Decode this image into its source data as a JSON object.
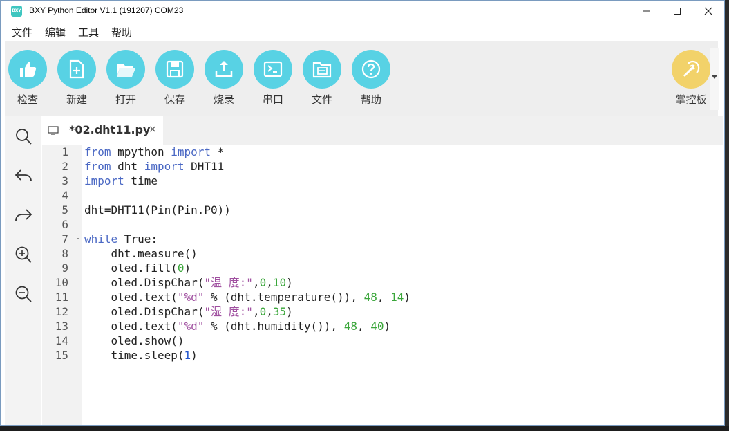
{
  "window": {
    "title": "BXY Python Editor V1.1 (191207) COM23",
    "app_icon_text": "BXY"
  },
  "menu": [
    "文件",
    "编辑",
    "工具",
    "帮助"
  ],
  "toolbar": {
    "items": [
      {
        "label": "检查",
        "icon": "thumbs-up-icon"
      },
      {
        "label": "新建",
        "icon": "new-file-icon"
      },
      {
        "label": "打开",
        "icon": "open-folder-icon"
      },
      {
        "label": "保存",
        "icon": "save-icon"
      },
      {
        "label": "烧录",
        "icon": "upload-icon"
      },
      {
        "label": "串口",
        "icon": "terminal-icon"
      },
      {
        "label": "文件",
        "icon": "files-icon"
      },
      {
        "label": "帮助",
        "icon": "help-icon"
      }
    ],
    "board_label": "掌控板",
    "colors": {
      "tool": "#58d2e4",
      "board": "#f2d26a"
    }
  },
  "sidebar": [
    "search-icon",
    "undo-icon",
    "redo-icon",
    "zoom-in-icon",
    "zoom-out-icon"
  ],
  "tab": {
    "title": "*02.dht11.py",
    "close": "×"
  },
  "editor": {
    "line_numbers": [
      "1",
      "2",
      "3",
      "4",
      "5",
      "6",
      "7",
      "8",
      "9",
      "10",
      "11",
      "12",
      "13",
      "14",
      "15"
    ],
    "fold_marker": "-",
    "lines": [
      [
        [
          "kw",
          "from"
        ],
        [
          "pl",
          " mpython "
        ],
        [
          "kw",
          "import"
        ],
        [
          "pl",
          " *"
        ]
      ],
      [
        [
          "kw",
          "from"
        ],
        [
          "pl",
          " dht "
        ],
        [
          "kw",
          "import"
        ],
        [
          "pl",
          " DHT11"
        ]
      ],
      [
        [
          "kw",
          "import"
        ],
        [
          "pl",
          " time"
        ]
      ],
      [],
      [
        [
          "pl",
          "dht=DHT11(Pin(Pin.P0))"
        ]
      ],
      [],
      [
        [
          "kw",
          "while"
        ],
        [
          "pl",
          " True:"
        ]
      ],
      [
        [
          "pl",
          "    dht.measure()"
        ]
      ],
      [
        [
          "pl",
          "    oled.fill("
        ],
        [
          "num",
          "0"
        ],
        [
          "pl",
          ")"
        ]
      ],
      [
        [
          "pl",
          "    oled.DispChar("
        ],
        [
          "str",
          "\"温 度:\""
        ],
        [
          "pl",
          ","
        ],
        [
          "num",
          "0"
        ],
        [
          "pl",
          ","
        ],
        [
          "num",
          "10"
        ],
        [
          "pl",
          ")"
        ]
      ],
      [
        [
          "pl",
          "    oled.text("
        ],
        [
          "str",
          "\"%d\""
        ],
        [
          "pl",
          " % (dht.temperature()), "
        ],
        [
          "num",
          "48"
        ],
        [
          "pl",
          ", "
        ],
        [
          "num",
          "14"
        ],
        [
          "pl",
          ")"
        ]
      ],
      [
        [
          "pl",
          "    oled.DispChar("
        ],
        [
          "str",
          "\"湿 度:\""
        ],
        [
          "pl",
          ","
        ],
        [
          "num",
          "0"
        ],
        [
          "pl",
          ","
        ],
        [
          "num",
          "35"
        ],
        [
          "pl",
          ")"
        ]
      ],
      [
        [
          "pl",
          "    oled.text("
        ],
        [
          "str",
          "\"%d\""
        ],
        [
          "pl",
          " % (dht.humidity()), "
        ],
        [
          "num",
          "48"
        ],
        [
          "pl",
          ", "
        ],
        [
          "num",
          "40"
        ],
        [
          "pl",
          ")"
        ]
      ],
      [
        [
          "pl",
          "    oled.show()"
        ]
      ],
      [
        [
          "pl",
          "    time.sleep("
        ],
        [
          "dk",
          "1"
        ],
        [
          "pl",
          ")"
        ]
      ]
    ]
  }
}
